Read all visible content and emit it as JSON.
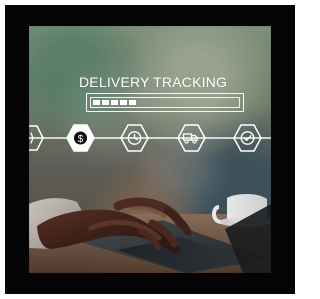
{
  "title": "DELIVERY TRACKING",
  "progress_level": 0.25,
  "icons": [
    "partial-hexagon-icon",
    "dollar-icon",
    "clock-icon",
    "truck-icon",
    "checkmark-icon"
  ],
  "colors": {
    "frame": "#050505",
    "overlay_white": "#ffffff",
    "dollar_fill": "#ffffff"
  }
}
